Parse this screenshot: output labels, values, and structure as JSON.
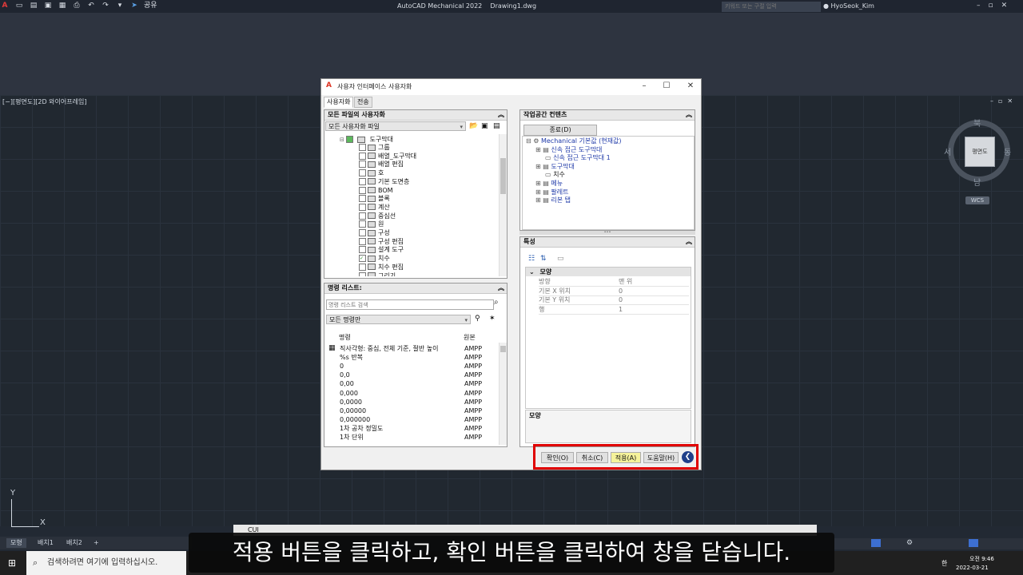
{
  "titlebar": {
    "app_title": "AutoCAD Mechanical 2022",
    "doc_title": "Drawing1.dwg",
    "share_label": "공유",
    "search_placeholder": "키워드 또는 구절 입력",
    "user": "HyoSeok_Kim"
  },
  "viewport": {
    "label": "[−][평면도][2D 와이어프레임]",
    "cube_face": "평면도",
    "compass_n": "북",
    "compass_s": "남",
    "compass_e": "동",
    "compass_w": "서",
    "wcs": "WCS",
    "ucs_x": "X",
    "ucs_y": "Y"
  },
  "dialog": {
    "title": "사용자 인터페이스 사용자화",
    "tabs": [
      "사용자화",
      "전송"
    ],
    "customizations_panel": {
      "header": "모든 파일의 사용자화",
      "combo": "모든 사용자화 파일",
      "tree_root": "도구막대",
      "tree_items": [
        {
          "label": "그룹",
          "checked": false
        },
        {
          "label": "배열_도구막대",
          "checked": false
        },
        {
          "label": "배열 편집",
          "checked": false
        },
        {
          "label": "호",
          "checked": false
        },
        {
          "label": "기본 도면층",
          "checked": false
        },
        {
          "label": "BOM",
          "checked": false
        },
        {
          "label": "블록",
          "checked": false
        },
        {
          "label": "계산",
          "checked": false
        },
        {
          "label": "중심선",
          "checked": false
        },
        {
          "label": "원",
          "checked": false
        },
        {
          "label": "구성",
          "checked": false
        },
        {
          "label": "구성 편집",
          "checked": false
        },
        {
          "label": "설계 도구",
          "checked": false
        },
        {
          "label": "치수",
          "checked": true
        },
        {
          "label": "치수 편집",
          "checked": false
        },
        {
          "label": "그리기",
          "checked": false
        }
      ]
    },
    "command_panel": {
      "header": "명령 리스트:",
      "search_placeholder": "명령 리스트 검색",
      "filter_combo": "모든 명령만",
      "col_command": "명령",
      "col_source": "원본",
      "rows": [
        {
          "name": "직사각형: 중심, 전체 기준, 절반 높이",
          "source": "AMPP"
        },
        {
          "name": "%s 반복",
          "source": "AMPP"
        },
        {
          "name": "0",
          "source": "AMPP"
        },
        {
          "name": "0,0",
          "source": "AMPP"
        },
        {
          "name": "0,00",
          "source": "AMPP"
        },
        {
          "name": "0,000",
          "source": "AMPP"
        },
        {
          "name": "0,0000",
          "source": "AMPP"
        },
        {
          "name": "0,00000",
          "source": "AMPP"
        },
        {
          "name": "0,000000",
          "source": "AMPP"
        },
        {
          "name": "1차 공차 정밀도",
          "source": "AMPP"
        },
        {
          "name": "1차 단위",
          "source": "AMPP"
        }
      ]
    },
    "workspace_panel": {
      "header": "작업공간 컨텐츠",
      "done_button": "종료(D)",
      "tree": [
        {
          "label": "Mechanical 기본값 (현재값)",
          "indent": 0
        },
        {
          "label": "신속 접근 도구막대",
          "indent": 1
        },
        {
          "label": "신속 접근 도구막대 1",
          "indent": 2
        },
        {
          "label": "도구막대",
          "indent": 1
        },
        {
          "label": "치수",
          "indent": 2
        },
        {
          "label": "메뉴",
          "indent": 1
        },
        {
          "label": "팔레트",
          "indent": 1
        },
        {
          "label": "리본 탭",
          "indent": 1
        }
      ]
    },
    "properties_panel": {
      "header": "특성",
      "category": "모양",
      "rows": [
        {
          "name": "방향",
          "value": "맨 위"
        },
        {
          "name": "기본 X 위치",
          "value": "0"
        },
        {
          "name": "기본 Y 위치",
          "value": "0"
        },
        {
          "name": "행",
          "value": "1"
        }
      ],
      "description_title": "모양"
    },
    "buttons": {
      "ok": "확인(O)",
      "cancel": "취소(C)",
      "apply": "적용(A)",
      "help": "도움말(H)"
    }
  },
  "bottom": {
    "layout_tabs": [
      "모형",
      "배치1",
      "배치2"
    ],
    "cmd_label": "CUI",
    "subtitle": "적용 버튼을 클릭하고, 확인 버튼을 클릭하여 창을 닫습니다.",
    "taskbar_search": "검색하려면 여기에 입력하십시오.",
    "clock_time": "오전 9:46",
    "clock_date": "2022-03-21",
    "ime": "한"
  }
}
